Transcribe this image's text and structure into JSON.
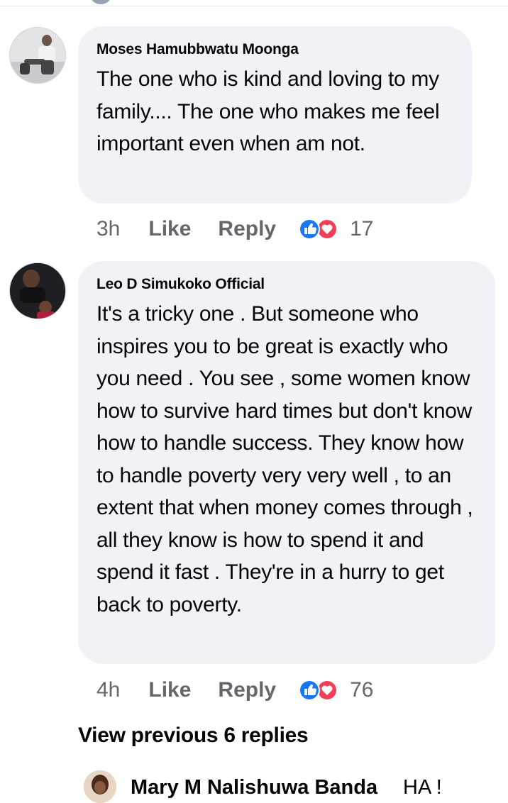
{
  "comments": [
    {
      "author": "Moses Hamubbwatu Moonga",
      "text": "The one who is kind and loving to my family.... The one who makes me feel important even when am not.",
      "time": "3h",
      "like_label": "Like",
      "reply_label": "Reply",
      "reaction_icons": [
        "like-icon",
        "love-icon"
      ],
      "reaction_count": "17"
    },
    {
      "author": "Leo D Simukoko Official",
      "text": "It's a tricky one . But someone who inspires you to be great is exactly who you need . You see , some women know how to survive hard times but don't know how to handle success. They know how to handle poverty very very well , to an extent that when money comes through , all they know is how to spend it and spend it fast . They're in a hurry to get back to poverty.",
      "time": "4h",
      "like_label": "Like",
      "reply_label": "Reply",
      "reaction_icons": [
        "like-icon",
        "love-icon"
      ],
      "reaction_count": "76"
    }
  ],
  "view_previous_label": "View previous 6 replies",
  "next_comment": {
    "author": "Mary M Nalishuwa Banda",
    "text_start": "HA !"
  },
  "colors": {
    "bubble": "#f0f2f5",
    "meta_text": "#65676b",
    "like_blue": "#1877f2",
    "love_red": "#f33e58"
  }
}
